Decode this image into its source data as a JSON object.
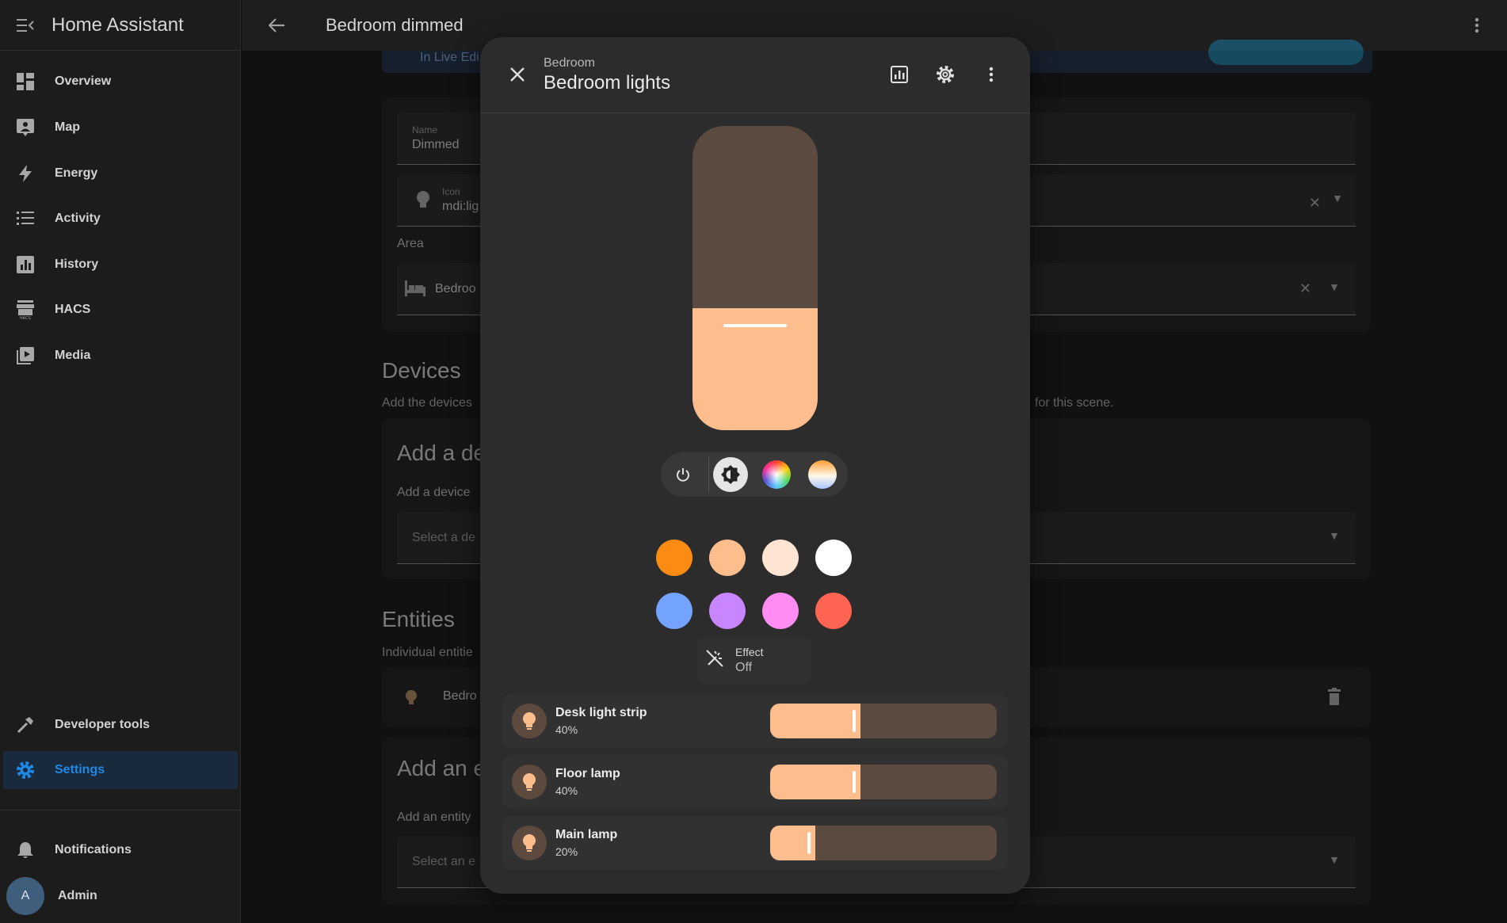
{
  "sidebar": {
    "title": "Home Assistant",
    "items": [
      {
        "label": "Overview",
        "icon": "overview-icon"
      },
      {
        "label": "Map",
        "icon": "map-icon"
      },
      {
        "label": "Energy",
        "icon": "energy-icon"
      },
      {
        "label": "Activity",
        "icon": "activity-icon"
      },
      {
        "label": "History",
        "icon": "history-icon"
      },
      {
        "label": "HACS",
        "icon": "hacs-icon"
      },
      {
        "label": "Media",
        "icon": "media-icon"
      }
    ],
    "dev_tools": "Developer tools",
    "settings": "Settings",
    "notifications": "Notifications",
    "user": {
      "name": "Admin",
      "initial": "A"
    }
  },
  "topbar": {
    "title": "Bedroom dimmed"
  },
  "editor": {
    "live_text": "In Live Edi",
    "name_label": "Name",
    "name_value": "Dimmed",
    "icon_label": "Icon",
    "icon_value": "mdi:lig",
    "area_label": "Area",
    "area_value": "Bedroo",
    "devices_heading": "Devices",
    "devices_sub_left": "Add the devices",
    "devices_sub_right": "for this scene.",
    "add_device_title": "Add a de",
    "add_device_label": "Add a device",
    "select_device_placeholder": "Select a de",
    "entities_heading": "Entities",
    "entities_sub": "Individual entitie",
    "entity_row": "Bedro",
    "add_entity_title": "Add an e",
    "add_entity_label": "Add an entity",
    "select_entity_placeholder": "Select an e"
  },
  "dialog": {
    "area": "Bedroom",
    "title": "Bedroom lights",
    "brightness_fraction": 0.4,
    "effect_label": "Effect",
    "effect_value": "Off",
    "swatches": [
      "#fb8c13",
      "#fdbd8d",
      "#fee4d3",
      "#ffffff",
      "#74a3fe",
      "#c985fe",
      "#fe8cf2",
      "#fe6452"
    ],
    "members": [
      {
        "name": "Desk light strip",
        "value": "40%",
        "level": 0.4
      },
      {
        "name": "Floor lamp",
        "value": "40%",
        "level": 0.4
      },
      {
        "name": "Main lamp",
        "value": "20%",
        "level": 0.2
      }
    ]
  },
  "colors": {
    "accent": "#1e88e5",
    "light_on": "#fdbd8d",
    "light_off_track": "#5a4a40"
  }
}
